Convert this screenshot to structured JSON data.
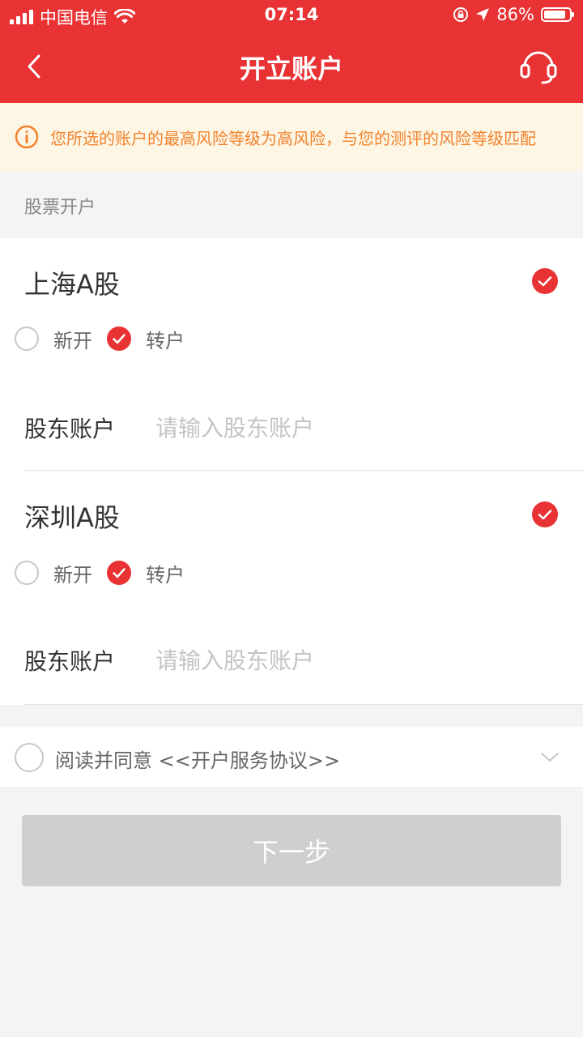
{
  "status_bar": {
    "carrier": "中国电信",
    "time": "07:14",
    "battery_percent": "86%",
    "battery_level": 0.86,
    "icons": [
      "signal-icon",
      "wifi-icon",
      "rotation-lock-icon",
      "location-icon",
      "battery-icon"
    ]
  },
  "nav": {
    "title": "开立账户",
    "back_icon": "chevron-left-icon",
    "service_icon": "headset-icon"
  },
  "notice": {
    "icon": "info-circle-icon",
    "text": "您所选的账户的最高风险等级为高风险，与您的测评的风险等级匹配"
  },
  "section": {
    "title": "股票开户"
  },
  "markets": [
    {
      "name": "上海A股",
      "checked": true,
      "options": [
        {
          "label": "新开",
          "selected": false
        },
        {
          "label": "转户",
          "selected": true
        }
      ],
      "field_label": "股东账户",
      "field_placeholder": "请输入股东账户",
      "field_value": ""
    },
    {
      "name": "深圳A股",
      "checked": true,
      "options": [
        {
          "label": "新开",
          "selected": false
        },
        {
          "label": "转户",
          "selected": true
        }
      ],
      "field_label": "股东账户",
      "field_placeholder": "请输入股东账户",
      "field_value": ""
    }
  ],
  "agreement": {
    "prefix": "阅读并同意 ",
    "link": "<<开户服务协议>>",
    "checked": false
  },
  "next_button": {
    "label": "下一步",
    "enabled": false
  },
  "colors": {
    "brand_red": "#e83234",
    "notice_bg": "#fef6e4",
    "notice_text": "#f0832f",
    "disabled_button": "#cfcfcf"
  }
}
